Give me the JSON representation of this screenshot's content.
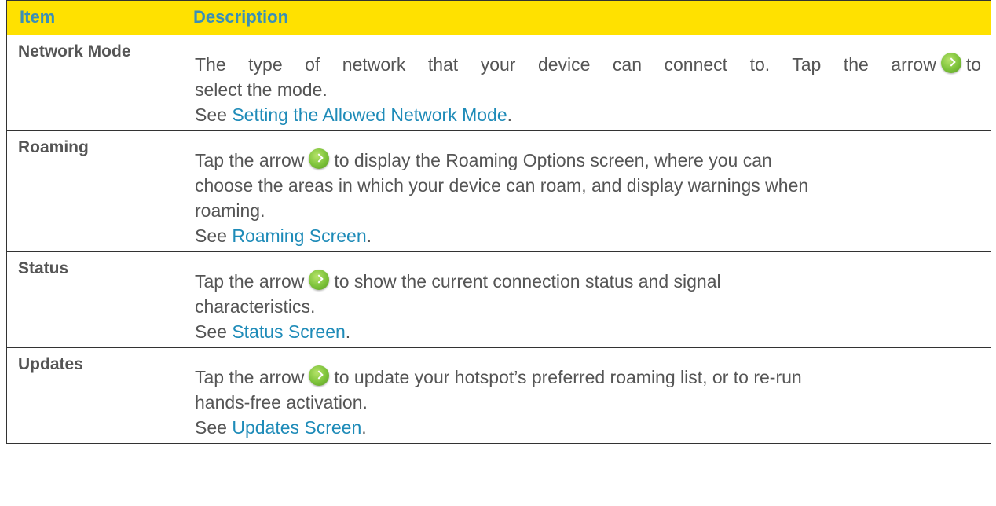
{
  "header": {
    "item": "Item",
    "description": "Description"
  },
  "rows": [
    {
      "item": "Network Mode",
      "desc_before_icon": "The type of network that your device can connect to. Tap the arrow",
      "desc_after_icon": "to",
      "desc_line2": "select the mode.",
      "see_prefix": "See ",
      "link": "Setting the Allowed Network Mode",
      "see_suffix": "."
    },
    {
      "item": "Roaming",
      "desc_before_icon": "Tap the arrow",
      "desc_after_icon": "to display the Roaming Options screen, where you can",
      "desc_line2": "choose the areas in which your device can roam, and display warnings when",
      "desc_line3": "roaming.",
      "see_prefix": "See ",
      "link": "Roaming Screen",
      "see_suffix": "."
    },
    {
      "item": "Status",
      "desc_before_icon": "Tap the arrow",
      "desc_after_icon": "to show the current connection status and signal",
      "desc_line2": "characteristics.",
      "see_prefix": "See ",
      "link": "Status Screen",
      "see_suffix": "."
    },
    {
      "item": "Updates",
      "desc_before_icon": "Tap the arrow",
      "desc_after_icon": "to update your hotspot’s preferred roaming list, or to re-run",
      "desc_line2": "hands-free activation.",
      "see_prefix": "See ",
      "link": "Updates Screen",
      "see_suffix": "."
    }
  ],
  "icons": {
    "arrow": "green-circle-arrow-icon"
  },
  "colors": {
    "header_bg": "#ffe100",
    "header_text": "#3a8fb7",
    "body_text": "#555555",
    "link": "#1e8bb8",
    "icon": "#7cc23a"
  }
}
